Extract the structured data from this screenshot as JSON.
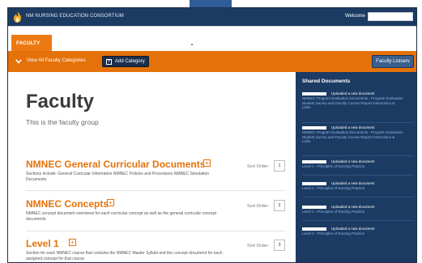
{
  "brand": {
    "name": "NM NURSING EDUCATION CONSORTIUM"
  },
  "topbar": {
    "welcome_label": "Welcome",
    "welcome_value": ""
  },
  "tabs": [
    {
      "label": "FACULTY",
      "active": true
    }
  ],
  "toolbar": {
    "view_all_label": "View All Faculty Categories",
    "add_category_label": "Add Category",
    "add_category_icon": "plus-icon",
    "listserv_label": "Faculty Listserv"
  },
  "main": {
    "title": "Faculty",
    "subtitle": "This is the faculty group",
    "sort_label": "Sort Order:",
    "categories": [
      {
        "title": "NMNEC General Curricular Documents",
        "description": "Sections include: General Curricular Information NMNEC Policies and Procedures NMNEC Simulation Documents",
        "sort_order": "1"
      },
      {
        "title": "NMNEC Concepts",
        "description": "NMNEC concept document overviews for each curricular concept as well as the general curricular concept documents",
        "sort_order": "2"
      },
      {
        "title": "Level 1",
        "description": "Section for each NMNEC course that contains the NMNEC Master Syllabi and the concept document for each assigned concept for that course",
        "sort_order": "3"
      }
    ]
  },
  "shared_documents": {
    "title": "Shared Documents",
    "entries": [
      {
        "action": "Uploaded a new document",
        "link": "NMNEC Program Evaluation Documents - Program Evaluation Student Survey and Faculty Course Report Instructions & Links"
      },
      {
        "action": "Uploaded a new document",
        "link": "NMNEC Program Evaluation Documents - Program Evaluation Student Survey and Faculty Course Report Instructions & Links"
      },
      {
        "action": "Uploaded a new document",
        "link": "Level 1 - Principles of Nursing Practice"
      },
      {
        "action": "Uploaded a new document",
        "link": "Level 1 - Principles of Nursing Practice"
      },
      {
        "action": "Uploaded a new document",
        "link": "Level 1 - Principles of Nursing Practice"
      },
      {
        "action": "Uploaded a new document",
        "link": "Level 1 - Principles of Nursing Practice"
      }
    ]
  },
  "colors": {
    "navy": "#1c3b63",
    "orange": "#e57208",
    "link_blue": "#8fb6e6"
  }
}
